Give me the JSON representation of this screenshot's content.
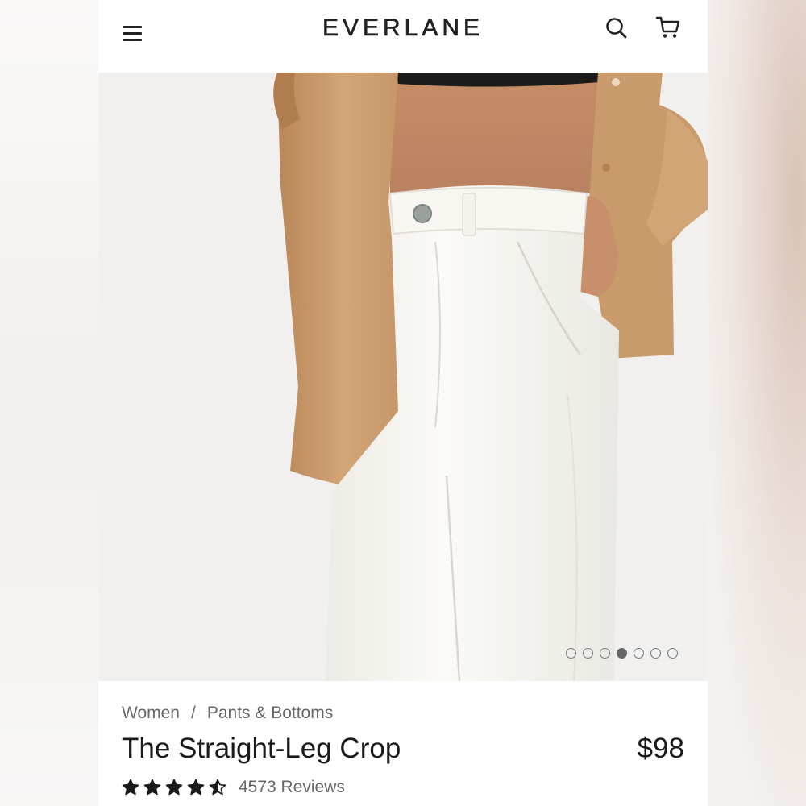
{
  "header": {
    "brand": "EVERLANE"
  },
  "icons": {
    "menu": "hamburger-menu-icon",
    "search": "search-icon",
    "cart": "shopping-cart-icon",
    "star": "star-icon"
  },
  "carousel": {
    "total_images": 7,
    "active_index": 4
  },
  "breadcrumb": {
    "level1": "Women",
    "separator": "/",
    "level2": "Pants & Bottoms"
  },
  "product": {
    "name": "The Straight-Leg Crop",
    "price": "$98",
    "rating": 4.5,
    "reviews_label": "4573 Reviews"
  },
  "colors": {
    "text": "#1a1a1a",
    "muted": "#666666",
    "jacket": "#c99a6b",
    "pants": "#f5f4ef"
  }
}
